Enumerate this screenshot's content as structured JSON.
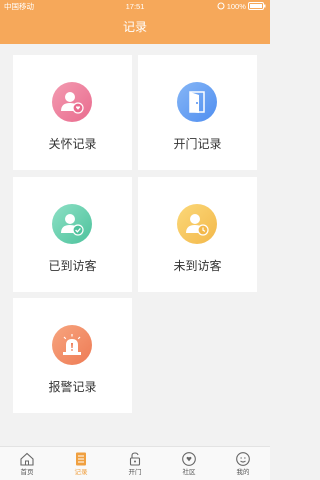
{
  "status_bar": {
    "carrier": "中国移动",
    "time": "17:51",
    "battery": "100%"
  },
  "header": {
    "title": "记录"
  },
  "cards": [
    {
      "label": "关怀记录",
      "icon": "care-person-heart-icon",
      "color": "#e96b8e"
    },
    {
      "label": "开门记录",
      "icon": "open-door-icon",
      "color": "#4f8ef0"
    },
    {
      "label": "已到访客",
      "icon": "visitor-arrived-check-icon",
      "color": "#4dc29c"
    },
    {
      "label": "未到访客",
      "icon": "visitor-pending-clock-icon",
      "color": "#f3b84a"
    },
    {
      "label": "报警记录",
      "icon": "alarm-siren-icon",
      "color": "#ee7b55"
    }
  ],
  "tabbar": {
    "items": [
      {
        "label": "首页",
        "icon": "home-icon",
        "active": false
      },
      {
        "label": "记录",
        "icon": "record-list-icon",
        "active": true
      },
      {
        "label": "开门",
        "icon": "unlock-icon",
        "active": false
      },
      {
        "label": "社区",
        "icon": "community-heart-icon",
        "active": false
      },
      {
        "label": "我的",
        "icon": "profile-icon",
        "active": false
      }
    ],
    "active_color": "#f0a040"
  }
}
